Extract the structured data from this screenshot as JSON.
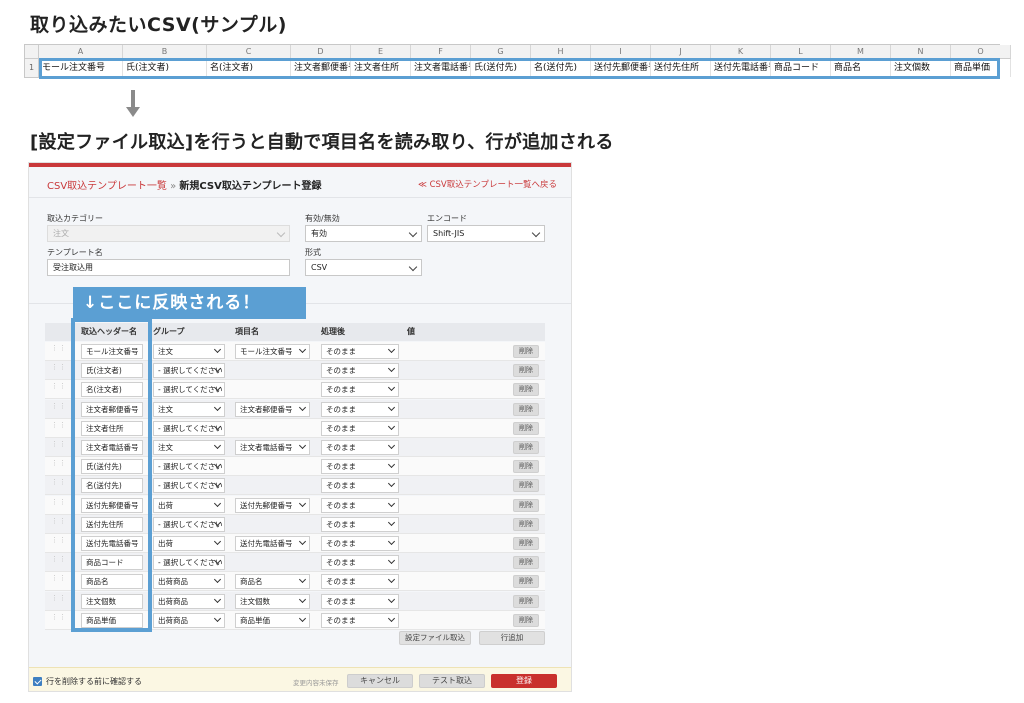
{
  "headings": {
    "top": "取り込みたいCSV(サンプル)",
    "mid": "[設定ファイル取込]を行うと自動で項目名を読み取り、行が追加される"
  },
  "spreadsheet": {
    "row_number": "1",
    "columns": [
      "A",
      "B",
      "C",
      "D",
      "E",
      "F",
      "G",
      "H",
      "I",
      "J",
      "K",
      "L",
      "M",
      "N",
      "O"
    ],
    "cells": [
      "モール注文番号",
      "氏(注文者)",
      "名(注文者)",
      "注文者郵便番号",
      "注文者住所",
      "注文者電話番号",
      "氏(送付先)",
      "名(送付先)",
      "送付先郵便番号",
      "送付先住所",
      "送付先電話番号",
      "商品コード",
      "商品名",
      "注文個数",
      "商品単価"
    ]
  },
  "breadcrumb": {
    "link": "CSV取込テンプレート一覧",
    "separator": "»",
    "current": "新規CSV取込テンプレート登録",
    "back": "≪ CSV取込テンプレート一覧へ戻る"
  },
  "form": {
    "category_label": "取込カテゴリー",
    "category_value": "注文",
    "enabled_label": "有効/無効",
    "enabled_value": "有効",
    "encode_label": "エンコード",
    "encode_value": "Shift-JIS",
    "template_label": "テンプレート名",
    "template_value": "受注取込用",
    "format_label": "形式",
    "format_value": "CSV"
  },
  "callout": "↓ここに反映される！",
  "table": {
    "headers": [
      "取込ヘッダー名",
      "グループ",
      "項目名",
      "処理後",
      "値"
    ],
    "delete_label": "削除",
    "rows": [
      {
        "header": "モール注文番号",
        "group": "注文",
        "item": "モール注文番号",
        "process": "そのまま"
      },
      {
        "header": "氏(注文者)",
        "group": "- 選択してください",
        "item": "",
        "process": "そのまま"
      },
      {
        "header": "名(注文者)",
        "group": "- 選択してください",
        "item": "",
        "process": "そのまま"
      },
      {
        "header": "注文者郵便番号",
        "group": "注文",
        "item": "注文者郵便番号",
        "process": "そのまま"
      },
      {
        "header": "注文者住所",
        "group": "- 選択してください",
        "item": "",
        "process": "そのまま"
      },
      {
        "header": "注文者電話番号",
        "group": "注文",
        "item": "注文者電話番号",
        "process": "そのまま"
      },
      {
        "header": "氏(送付先)",
        "group": "- 選択してください",
        "item": "",
        "process": "そのまま"
      },
      {
        "header": "名(送付先)",
        "group": "- 選択してください",
        "item": "",
        "process": "そのまま"
      },
      {
        "header": "送付先郵便番号",
        "group": "出荷",
        "item": "送付先郵便番号",
        "process": "そのまま"
      },
      {
        "header": "送付先住所",
        "group": "- 選択してください",
        "item": "",
        "process": "そのまま"
      },
      {
        "header": "送付先電話番号",
        "group": "出荷",
        "item": "送付先電話番号",
        "process": "そのまま"
      },
      {
        "header": "商品コード",
        "group": "- 選択してください",
        "item": "",
        "process": "そのまま"
      },
      {
        "header": "商品名",
        "group": "出荷商品",
        "item": "商品名",
        "process": "そのまま"
      },
      {
        "header": "注文個数",
        "group": "出荷商品",
        "item": "注文個数",
        "process": "そのまま"
      },
      {
        "header": "商品単価",
        "group": "出荷商品",
        "item": "商品単価",
        "process": "そのまま"
      }
    ]
  },
  "table_actions": {
    "import_settings": "設定ファイル取込",
    "add_row": "行追加"
  },
  "footer": {
    "confirm_label": "行を削除する前に確認する",
    "unsaved": "変更内容未保存",
    "cancel": "キャンセル",
    "test_import": "テスト取込",
    "register": "登録"
  },
  "colors": {
    "accent": "#c9383a",
    "highlight": "#5b9fd3"
  }
}
